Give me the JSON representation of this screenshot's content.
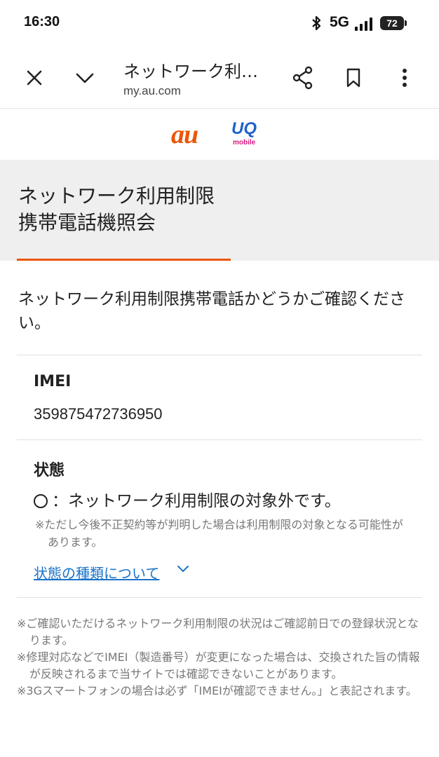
{
  "statusbar": {
    "time": "16:30",
    "network": "5G",
    "battery": "72"
  },
  "browser": {
    "title": "ネットワーク利…",
    "url": "my.au.com"
  },
  "logos": {
    "au": "au",
    "uq": "UQ",
    "uq_sub": "mobile"
  },
  "page": {
    "heading_line1": "ネットワーク利用制限",
    "heading_line2": "携帯電話機照会",
    "intro": "ネットワーク利用制限携帯電話かどうかご確認ください。",
    "imei_label": "IMEI",
    "imei_value": "359875472736950",
    "status_label": "状態",
    "status_symbol": "〇",
    "status_text": "：ネットワーク利用制限の対象外です。",
    "status_note": "※ただし今後不正契約等が判明した場合は利用制限の対象となる可能性があります。",
    "status_link": "状態の種類について",
    "footnotes": [
      "※ご確認いただけるネットワーク利用制限の状況はご確認前日での登録状況となります。",
      "※修理対応などでIMEI（製造番号）が変更になった場合は、交換された旨の情報が反映されるまで当サイトでは確認できないことがあります。",
      "※3Gスマートフォンの場合は必ず「IMEIが確認できません。」と表記されます。"
    ]
  },
  "colors": {
    "accent": "#eb5505",
    "link": "#1a73c9",
    "uq_blue": "#1f62c9",
    "uq_pink": "#d7177e"
  },
  "icons": [
    "bluetooth-icon",
    "signal-icon",
    "battery-icon",
    "close-icon",
    "chevron-down-icon",
    "share-icon",
    "bookmark-icon",
    "more-vert-icon"
  ]
}
